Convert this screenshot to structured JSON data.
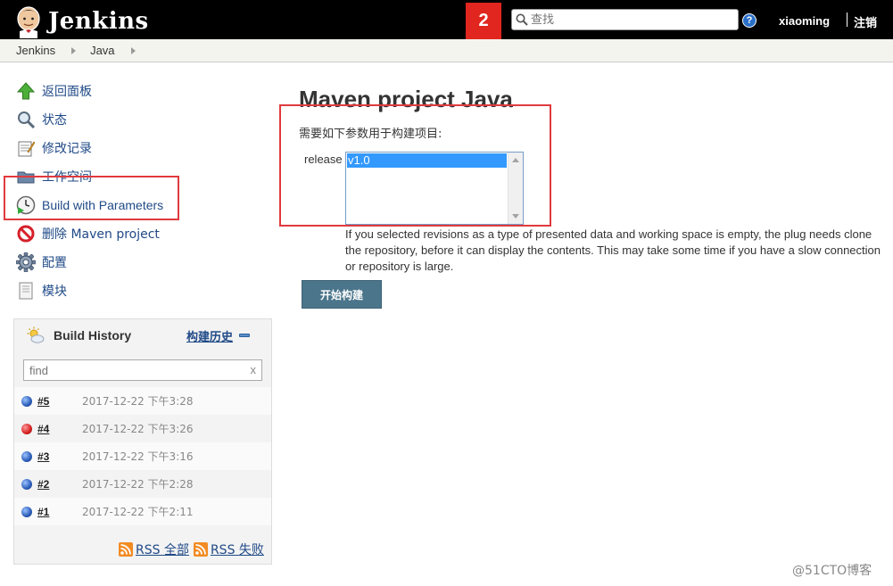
{
  "header": {
    "app_title": "Jenkins",
    "notification_count": "2",
    "search_placeholder": "查找",
    "help_label": "?",
    "user": "xiaoming",
    "logout": "注销"
  },
  "breadcrumb": [
    "Jenkins",
    "Java"
  ],
  "tasks": [
    {
      "label": "返回面板",
      "icon": "up-arrow-icon"
    },
    {
      "label": "状态",
      "icon": "magnifier-icon"
    },
    {
      "label": "修改记录",
      "icon": "notepad-icon"
    },
    {
      "label": "工作空间",
      "icon": "folder-icon"
    },
    {
      "label": "Build with Parameters",
      "icon": "clock-play-icon"
    },
    {
      "label": "删除 Maven project",
      "icon": "no-entry-icon"
    },
    {
      "label": "配置",
      "icon": "gear-icon"
    },
    {
      "label": "模块",
      "icon": "document-icon"
    }
  ],
  "build_history": {
    "title": "Build History",
    "trend_link": "构建历史",
    "filter_placeholder": "find",
    "clear_label": "x",
    "builds": [
      {
        "number": "#5",
        "date": "2017-12-22 下午3:28",
        "status": "blue"
      },
      {
        "number": "#4",
        "date": "2017-12-22 下午3:26",
        "status": "red"
      },
      {
        "number": "#3",
        "date": "2017-12-22 下午3:16",
        "status": "blue"
      },
      {
        "number": "#2",
        "date": "2017-12-22 下午2:28",
        "status": "blue"
      },
      {
        "number": "#1",
        "date": "2017-12-22 下午2:11",
        "status": "blue"
      }
    ],
    "rss_all": "RSS 全部",
    "rss_failed": "RSS 失败"
  },
  "main": {
    "title": "Maven project Java",
    "description": "需要如下参数用于构建项目:",
    "param_name": "release",
    "param_options": [
      "v1.0"
    ],
    "param_selected": "v1.0",
    "param_help": "If you selected revisions as a type of presented data and working space is empty, the plug needs clone the repository, before it can display the contents. This may take some time if you have a slow connection or repository is large.",
    "build_button": "开始构建"
  },
  "colors": {
    "header_bg": "#000000",
    "notification_bg": "#e0261f",
    "highlight_border": "#e03a3e",
    "build_button_bg": "#4b758b",
    "link": "#204a87"
  },
  "watermark": "@51CTO博客"
}
